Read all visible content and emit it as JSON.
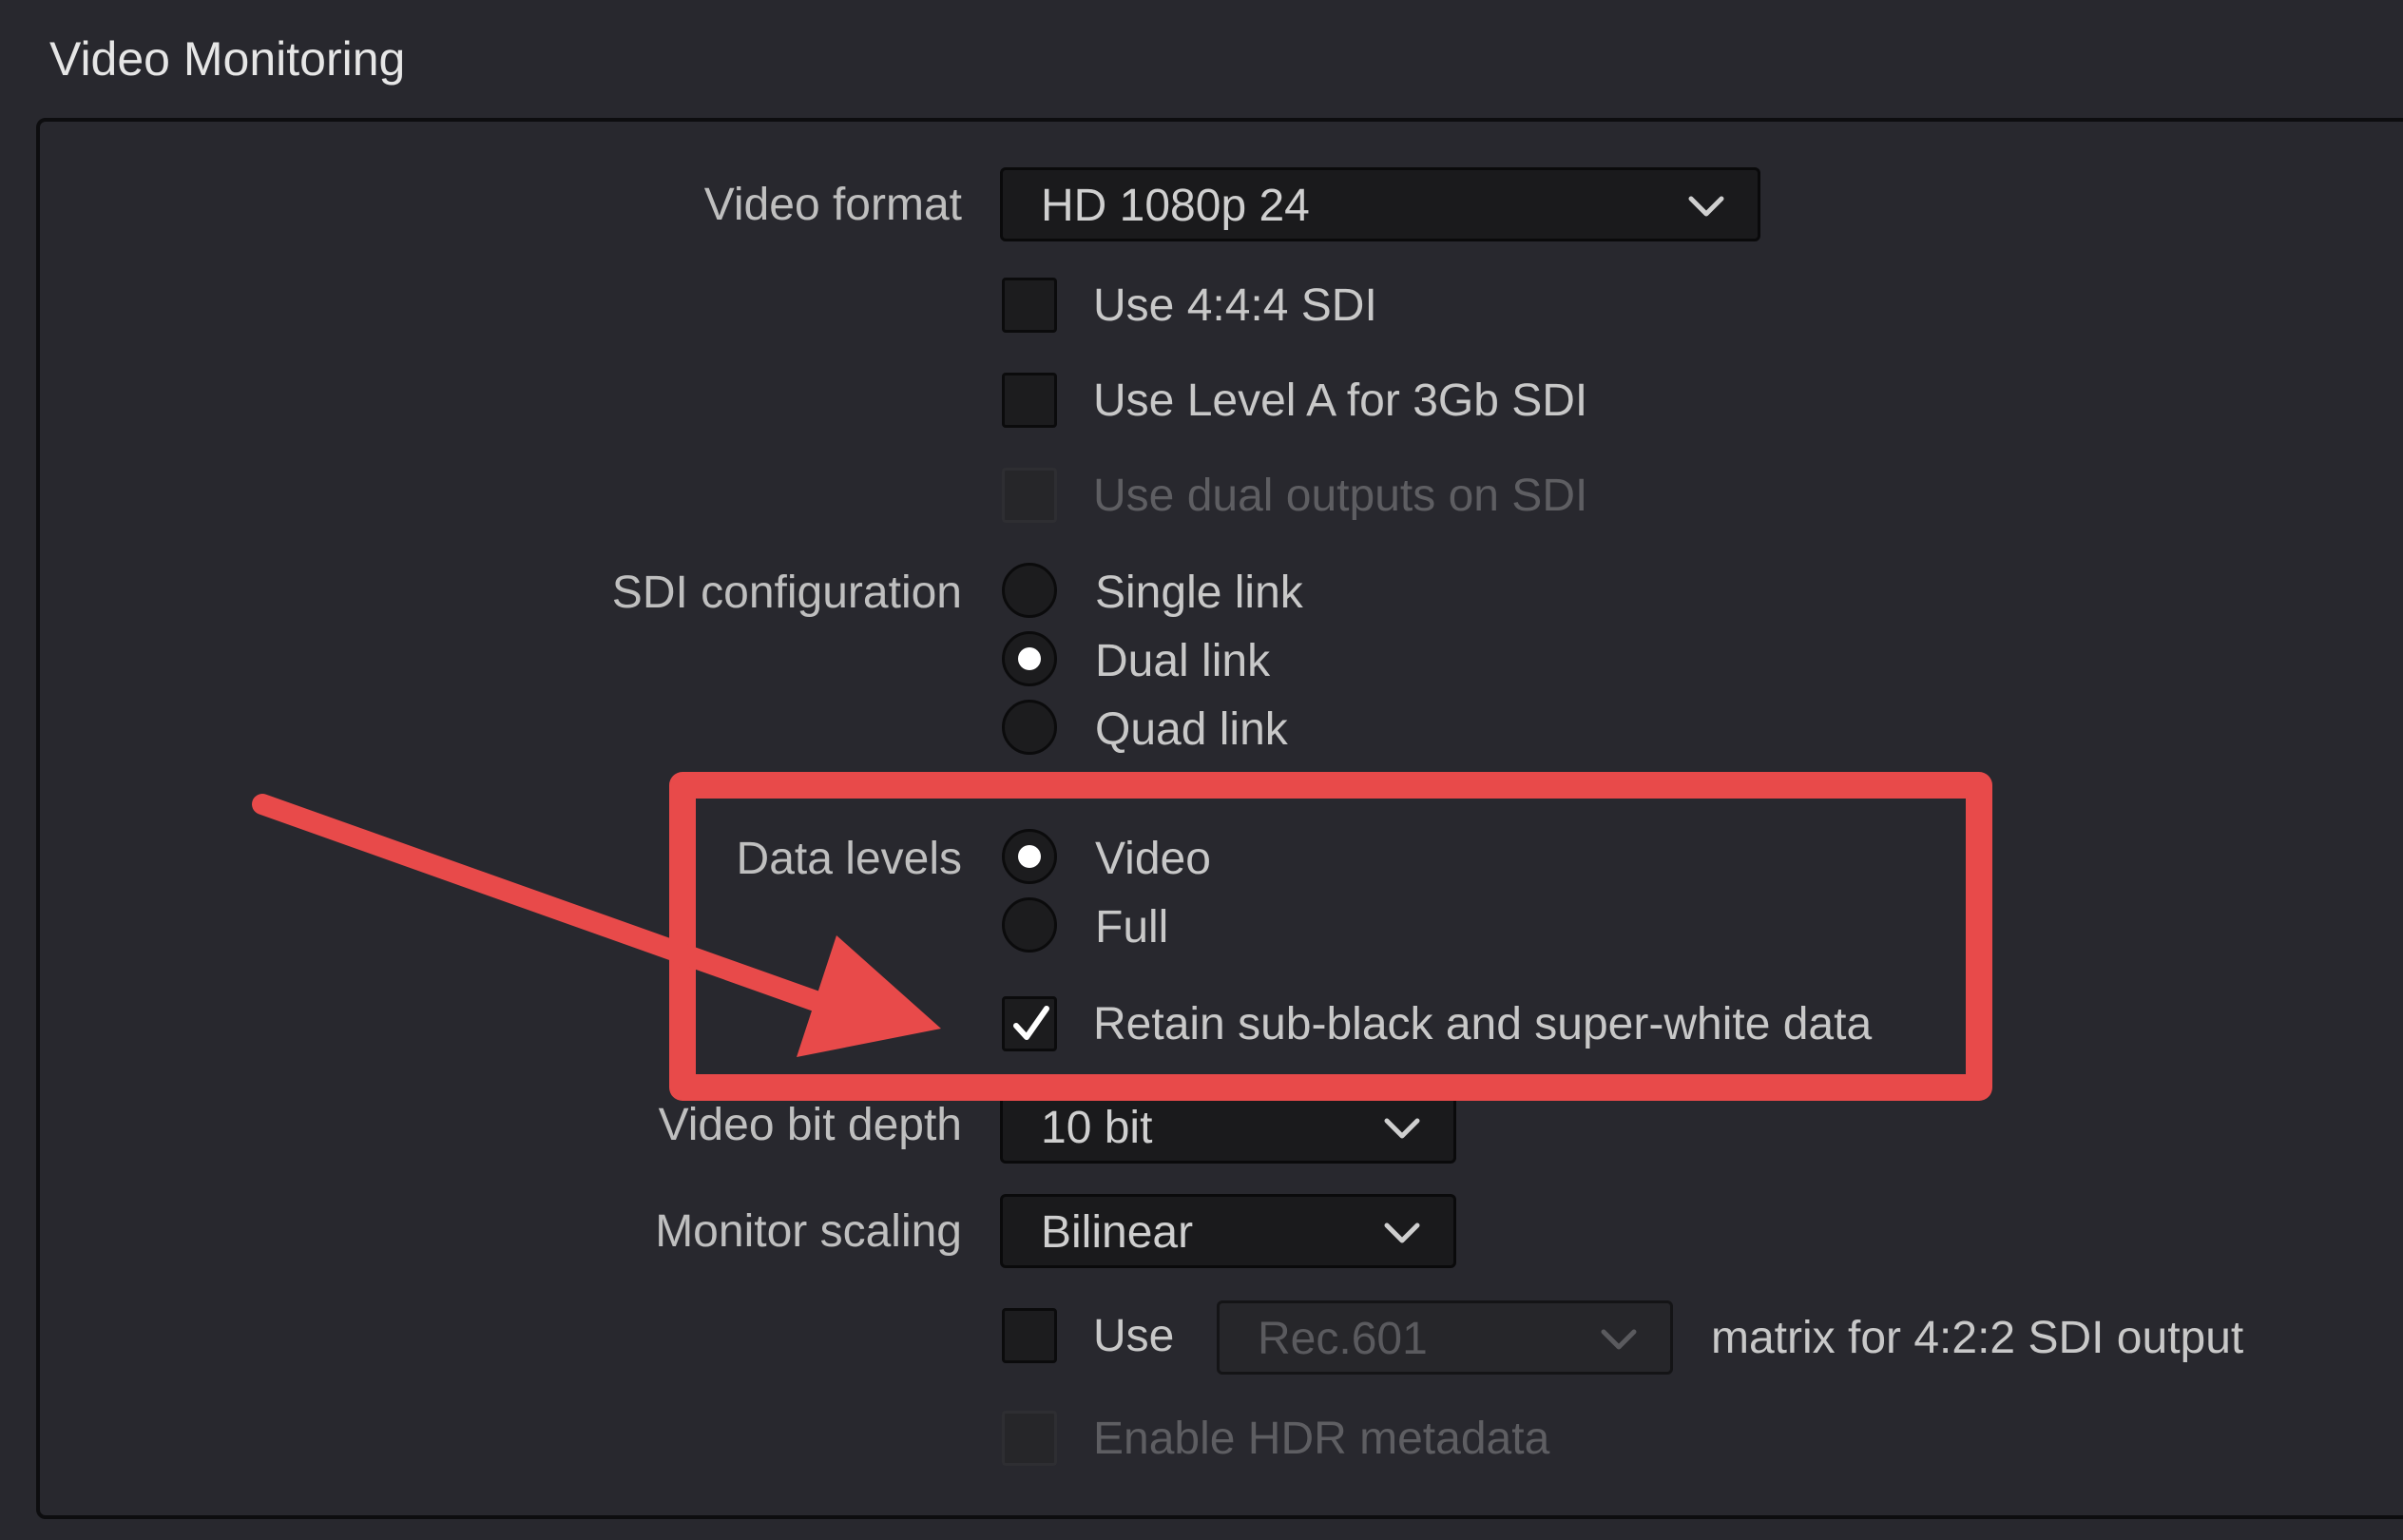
{
  "section": {
    "title": "Video Monitoring"
  },
  "video_format": {
    "label": "Video format",
    "value": "HD 1080p 24"
  },
  "checkboxes_sdi": [
    {
      "label": "Use 4:4:4 SDI",
      "checked": false,
      "enabled": true
    },
    {
      "label": "Use Level A for 3Gb SDI",
      "checked": false,
      "enabled": true
    },
    {
      "label": "Use dual outputs on SDI",
      "checked": false,
      "enabled": false
    }
  ],
  "sdi_configuration": {
    "label": "SDI configuration",
    "options": [
      "Single link",
      "Dual link",
      "Quad link"
    ],
    "selected": "Dual link"
  },
  "data_levels": {
    "label": "Data levels",
    "options": [
      "Video",
      "Full"
    ],
    "selected": "Video",
    "retain_label": "Retain sub-black and super-white data",
    "retain_checked": true
  },
  "video_bit_depth": {
    "label": "Video bit depth",
    "value": "10 bit"
  },
  "monitor_scaling": {
    "label": "Monitor scaling",
    "value": "Bilinear"
  },
  "matrix": {
    "use_label": "Use",
    "value": "Rec.601",
    "suffix": "matrix for 4:2:2 SDI output",
    "checked": false
  },
  "hdr": {
    "label": "Enable HDR metadata",
    "enabled": false
  },
  "colors": {
    "background": "#28282e",
    "highlight": "#e84a4a",
    "field": "#1a1a1c"
  }
}
